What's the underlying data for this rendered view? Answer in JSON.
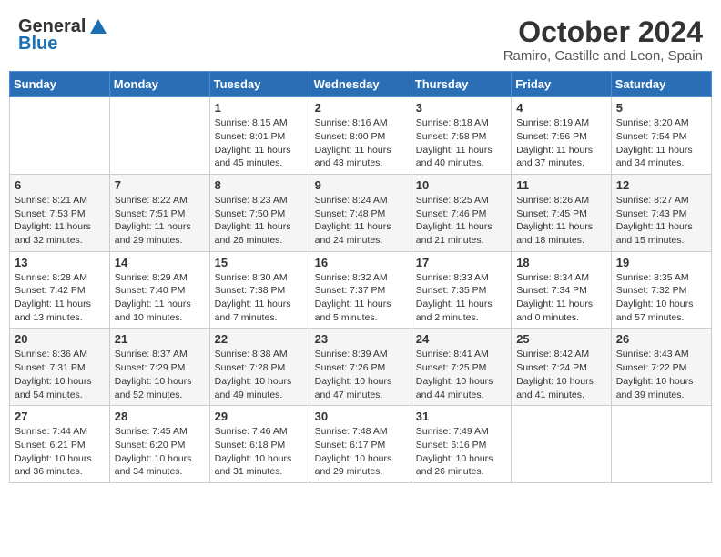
{
  "header": {
    "logo_general": "General",
    "logo_blue": "Blue",
    "month_title": "October 2024",
    "subtitle": "Ramiro, Castille and Leon, Spain"
  },
  "weekdays": [
    "Sunday",
    "Monday",
    "Tuesday",
    "Wednesday",
    "Thursday",
    "Friday",
    "Saturday"
  ],
  "weeks": [
    [
      {
        "day": "",
        "info": ""
      },
      {
        "day": "",
        "info": ""
      },
      {
        "day": "1",
        "info": "Sunrise: 8:15 AM\nSunset: 8:01 PM\nDaylight: 11 hours and 45 minutes."
      },
      {
        "day": "2",
        "info": "Sunrise: 8:16 AM\nSunset: 8:00 PM\nDaylight: 11 hours and 43 minutes."
      },
      {
        "day": "3",
        "info": "Sunrise: 8:18 AM\nSunset: 7:58 PM\nDaylight: 11 hours and 40 minutes."
      },
      {
        "day": "4",
        "info": "Sunrise: 8:19 AM\nSunset: 7:56 PM\nDaylight: 11 hours and 37 minutes."
      },
      {
        "day": "5",
        "info": "Sunrise: 8:20 AM\nSunset: 7:54 PM\nDaylight: 11 hours and 34 minutes."
      }
    ],
    [
      {
        "day": "6",
        "info": "Sunrise: 8:21 AM\nSunset: 7:53 PM\nDaylight: 11 hours and 32 minutes."
      },
      {
        "day": "7",
        "info": "Sunrise: 8:22 AM\nSunset: 7:51 PM\nDaylight: 11 hours and 29 minutes."
      },
      {
        "day": "8",
        "info": "Sunrise: 8:23 AM\nSunset: 7:50 PM\nDaylight: 11 hours and 26 minutes."
      },
      {
        "day": "9",
        "info": "Sunrise: 8:24 AM\nSunset: 7:48 PM\nDaylight: 11 hours and 24 minutes."
      },
      {
        "day": "10",
        "info": "Sunrise: 8:25 AM\nSunset: 7:46 PM\nDaylight: 11 hours and 21 minutes."
      },
      {
        "day": "11",
        "info": "Sunrise: 8:26 AM\nSunset: 7:45 PM\nDaylight: 11 hours and 18 minutes."
      },
      {
        "day": "12",
        "info": "Sunrise: 8:27 AM\nSunset: 7:43 PM\nDaylight: 11 hours and 15 minutes."
      }
    ],
    [
      {
        "day": "13",
        "info": "Sunrise: 8:28 AM\nSunset: 7:42 PM\nDaylight: 11 hours and 13 minutes."
      },
      {
        "day": "14",
        "info": "Sunrise: 8:29 AM\nSunset: 7:40 PM\nDaylight: 11 hours and 10 minutes."
      },
      {
        "day": "15",
        "info": "Sunrise: 8:30 AM\nSunset: 7:38 PM\nDaylight: 11 hours and 7 minutes."
      },
      {
        "day": "16",
        "info": "Sunrise: 8:32 AM\nSunset: 7:37 PM\nDaylight: 11 hours and 5 minutes."
      },
      {
        "day": "17",
        "info": "Sunrise: 8:33 AM\nSunset: 7:35 PM\nDaylight: 11 hours and 2 minutes."
      },
      {
        "day": "18",
        "info": "Sunrise: 8:34 AM\nSunset: 7:34 PM\nDaylight: 11 hours and 0 minutes."
      },
      {
        "day": "19",
        "info": "Sunrise: 8:35 AM\nSunset: 7:32 PM\nDaylight: 10 hours and 57 minutes."
      }
    ],
    [
      {
        "day": "20",
        "info": "Sunrise: 8:36 AM\nSunset: 7:31 PM\nDaylight: 10 hours and 54 minutes."
      },
      {
        "day": "21",
        "info": "Sunrise: 8:37 AM\nSunset: 7:29 PM\nDaylight: 10 hours and 52 minutes."
      },
      {
        "day": "22",
        "info": "Sunrise: 8:38 AM\nSunset: 7:28 PM\nDaylight: 10 hours and 49 minutes."
      },
      {
        "day": "23",
        "info": "Sunrise: 8:39 AM\nSunset: 7:26 PM\nDaylight: 10 hours and 47 minutes."
      },
      {
        "day": "24",
        "info": "Sunrise: 8:41 AM\nSunset: 7:25 PM\nDaylight: 10 hours and 44 minutes."
      },
      {
        "day": "25",
        "info": "Sunrise: 8:42 AM\nSunset: 7:24 PM\nDaylight: 10 hours and 41 minutes."
      },
      {
        "day": "26",
        "info": "Sunrise: 8:43 AM\nSunset: 7:22 PM\nDaylight: 10 hours and 39 minutes."
      }
    ],
    [
      {
        "day": "27",
        "info": "Sunrise: 7:44 AM\nSunset: 6:21 PM\nDaylight: 10 hours and 36 minutes."
      },
      {
        "day": "28",
        "info": "Sunrise: 7:45 AM\nSunset: 6:20 PM\nDaylight: 10 hours and 34 minutes."
      },
      {
        "day": "29",
        "info": "Sunrise: 7:46 AM\nSunset: 6:18 PM\nDaylight: 10 hours and 31 minutes."
      },
      {
        "day": "30",
        "info": "Sunrise: 7:48 AM\nSunset: 6:17 PM\nDaylight: 10 hours and 29 minutes."
      },
      {
        "day": "31",
        "info": "Sunrise: 7:49 AM\nSunset: 6:16 PM\nDaylight: 10 hours and 26 minutes."
      },
      {
        "day": "",
        "info": ""
      },
      {
        "day": "",
        "info": ""
      }
    ]
  ]
}
